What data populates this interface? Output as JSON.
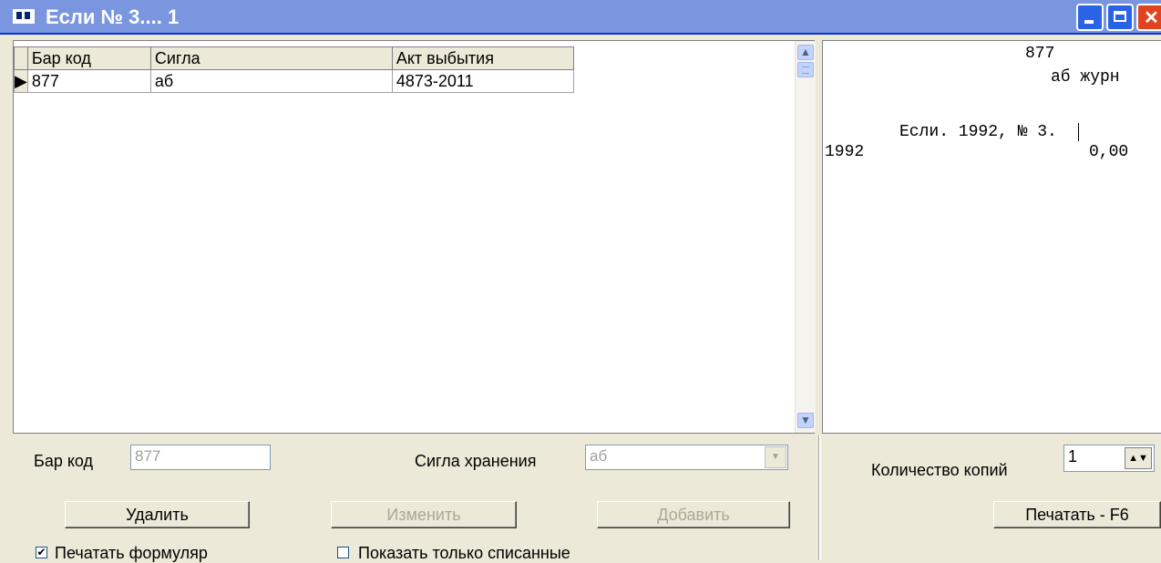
{
  "window": {
    "title": "Если № 3.... 1"
  },
  "grid": {
    "columns": [
      "Бар код",
      "Сигла",
      "Акт выбытия"
    ],
    "rows": [
      {
        "indicator": "▶",
        "cells": [
          "877",
          "аб",
          "4873-2011"
        ]
      }
    ]
  },
  "preview": {
    "lines": [
      "877",
      "аб журн",
      "Если. 1992, № 3.",
      "1992",
      "0,00"
    ]
  },
  "form": {
    "barcode_label": "Бар код",
    "barcode_value": "877",
    "storage_label": "Сигла хранения",
    "storage_value": "аб",
    "delete_label": "Удалить",
    "edit_label": "Изменить",
    "add_label": "Добавить",
    "print_form_label": "Печатать формуляр",
    "print_form_checked": "✔",
    "show_written_off_label": "Показать только списанные",
    "copies_label": "Количество копий",
    "copies_value": "1",
    "print_label": "Печатать - F6"
  },
  "icons": {
    "window": "book-icon",
    "minimize": "minimize-icon",
    "maximize": "maximize-icon",
    "close": "close-icon",
    "scroll_up": "chevron-up-icon",
    "scroll_down": "chevron-down-icon",
    "combo": "chevron-down-icon",
    "spin": "spin-arrows-icon"
  },
  "colors": {
    "titlebar": "#7a96df",
    "close_button": "#e0441e",
    "disabled_text": "#aca899",
    "window_bg": "#ece9d8"
  }
}
